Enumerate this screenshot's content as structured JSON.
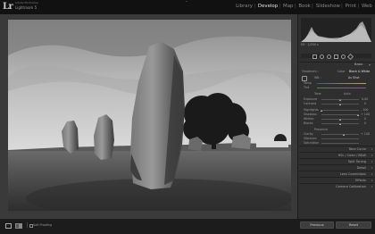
{
  "app": {
    "logo": "Lr",
    "catalog": "Adobe Photoshop",
    "product": "Lightroom 5"
  },
  "modules": [
    "Library",
    "Develop",
    "Map",
    "Book",
    "Slideshow",
    "Print",
    "Web"
  ],
  "active_module": "Develop",
  "histogram": {
    "info": "f/9  ·  1/250 s"
  },
  "panel": {
    "basic": {
      "title": "Basic",
      "treatment_label": "Treatment :",
      "treatment_color": "Color",
      "treatment_bw": "Black & White",
      "wb_label": "WB :",
      "wb_value": "As Shot",
      "temp_label": "Temp",
      "tint_label": "Tint",
      "tone_label": "Tone",
      "tone_auto": "Auto",
      "exposure_label": "Exposure",
      "exposure_value": "0.00",
      "contrast_label": "Contrast",
      "contrast_value": "0",
      "highlights_label": "Highlights",
      "highlights_value": "- 100",
      "shadows_label": "Shadows",
      "shadows_value": "+ 100",
      "whites_label": "Whites",
      "whites_value": "0",
      "blacks_label": "Blacks",
      "blacks_value": "0",
      "presence_label": "Presence",
      "clarity_label": "Clarity",
      "clarity_value": "+ 100",
      "vibrance_label": "Vibrance",
      "saturation_label": "Saturation"
    },
    "sections": [
      "Tone Curve",
      "HSL / Color / B&W",
      "Split Toning",
      "Detail",
      "Lens Corrections",
      "Effects",
      "Camera Calibration"
    ]
  },
  "bottom": {
    "filmstrip_label": "Soft Proofing",
    "previous_btn": "Previous",
    "reset_btn": "Reset"
  },
  "colors": {
    "topbar": "#111111",
    "panel": "#2f2f2f",
    "active_module": "#e6e6e6"
  }
}
